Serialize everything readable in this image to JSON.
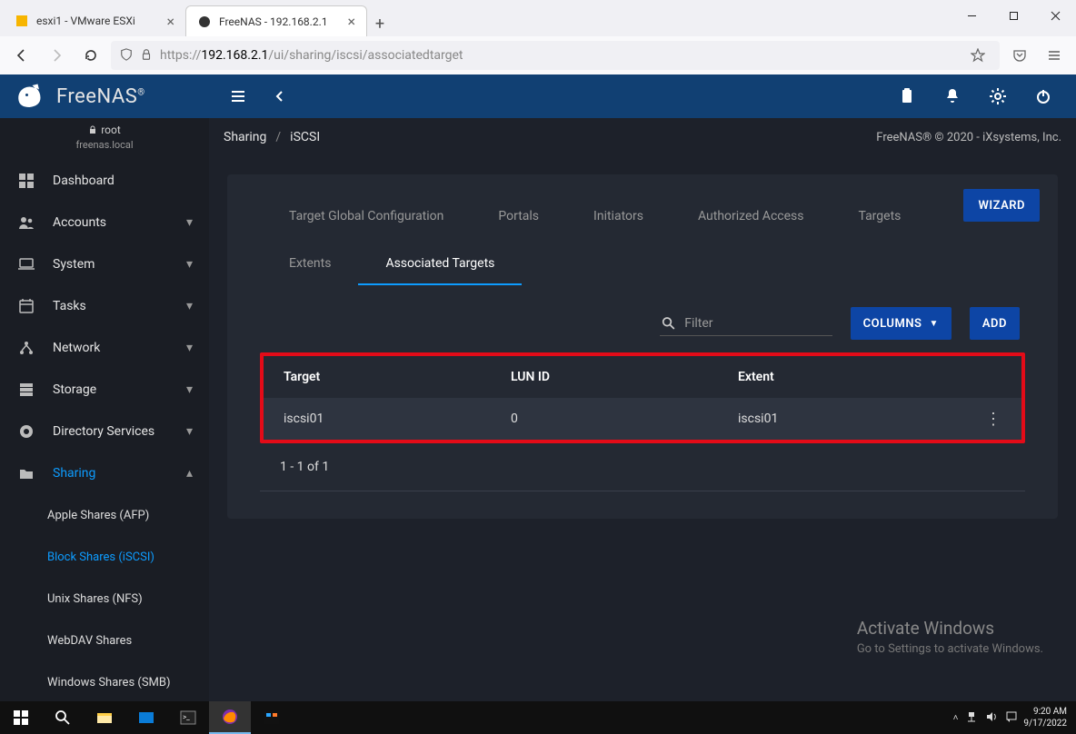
{
  "browser": {
    "tabs": [
      {
        "title": "esxi1 - VMware ESXi",
        "active": false
      },
      {
        "title": "FreeNAS - 192.168.2.1",
        "active": true
      }
    ],
    "url_prefix": "https://",
    "url_host": "192.168.2.1",
    "url_path": "/ui/sharing/iscsi/associatedtarget"
  },
  "header": {
    "product": "FreeNAS",
    "tm": "®"
  },
  "user": {
    "name": "root",
    "host": "freenas.local"
  },
  "sidebar": {
    "items": [
      {
        "label": "Dashboard",
        "icon": "dashboard",
        "expandable": false
      },
      {
        "label": "Accounts",
        "icon": "people",
        "expandable": true
      },
      {
        "label": "System",
        "icon": "laptop",
        "expandable": true
      },
      {
        "label": "Tasks",
        "icon": "calendar",
        "expandable": true
      },
      {
        "label": "Network",
        "icon": "network",
        "expandable": true
      },
      {
        "label": "Storage",
        "icon": "storage",
        "expandable": true
      },
      {
        "label": "Directory Services",
        "icon": "dirserv",
        "expandable": true
      },
      {
        "label": "Sharing",
        "icon": "folder-share",
        "expandable": true,
        "active": true,
        "expanded": true
      }
    ],
    "sharing_children": [
      {
        "label": "Apple Shares (AFP)"
      },
      {
        "label": "Block Shares (iSCSI)",
        "active": true
      },
      {
        "label": "Unix Shares (NFS)"
      },
      {
        "label": "WebDAV Shares"
      },
      {
        "label": "Windows Shares (SMB)"
      }
    ]
  },
  "breadcrumb": {
    "a": "Sharing",
    "b": "iSCSI"
  },
  "copyright": "FreeNAS® © 2020 - iXsystems, Inc.",
  "buttons": {
    "wizard": "WIZARD",
    "columns": "COLUMNS",
    "add": "ADD"
  },
  "tabs": {
    "row1": [
      "Target Global Configuration",
      "Portals",
      "Initiators",
      "Authorized Access",
      "Targets"
    ],
    "row2": [
      "Extents",
      "Associated Targets"
    ],
    "active": "Associated Targets"
  },
  "filter": {
    "placeholder": "Filter"
  },
  "table": {
    "headers": {
      "target": "Target",
      "lun": "LUN ID",
      "extent": "Extent"
    },
    "rows": [
      {
        "target": "iscsi01",
        "lun": "0",
        "extent": "iscsi01"
      }
    ],
    "pager": "1 - 1 of 1"
  },
  "watermark": {
    "title": "Activate Windows",
    "sub": "Go to Settings to activate Windows."
  },
  "taskbar": {
    "time": "9:20 AM",
    "date": "9/17/2022"
  }
}
